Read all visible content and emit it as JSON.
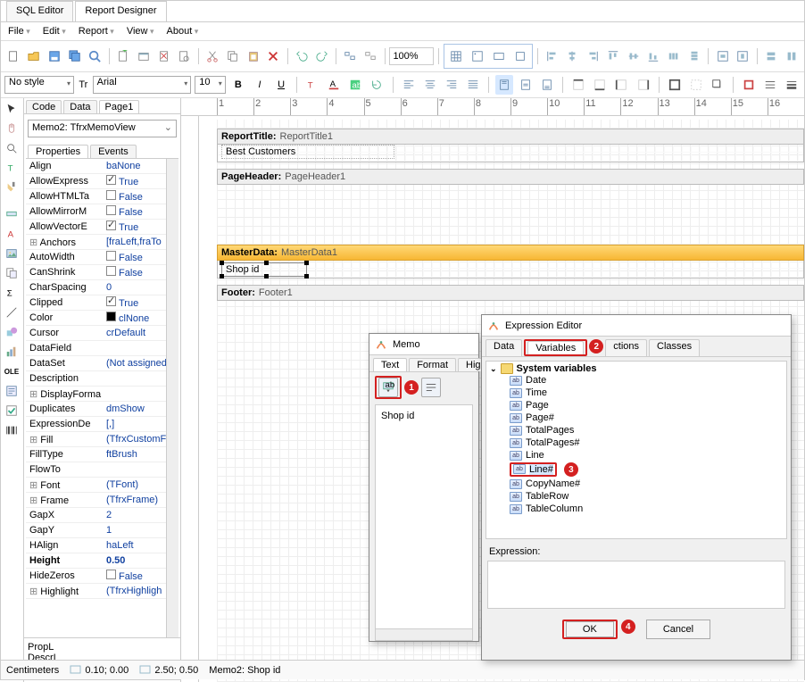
{
  "app_tabs": {
    "sql": "SQL Editor",
    "designer": "Report Designer"
  },
  "menu": {
    "file": "File",
    "edit": "Edit",
    "report": "Report",
    "view": "View",
    "about": "About"
  },
  "toolbar": {
    "zoom": "100%"
  },
  "style": {
    "none": "No style",
    "font": "Arial",
    "size": "10"
  },
  "code_tabs": {
    "code": "Code",
    "data": "Data",
    "page": "Page1"
  },
  "object": "Memo2: TfrxMemoView",
  "pe_tabs": {
    "props": "Properties",
    "events": "Events"
  },
  "props": [
    {
      "k": "Align",
      "v": "baNone"
    },
    {
      "k": "AllowExpress",
      "cb": true,
      "v": "True"
    },
    {
      "k": "AllowHTMLTa",
      "cb": false,
      "v": "False"
    },
    {
      "k": "AllowMirrorM",
      "cb": false,
      "v": "False"
    },
    {
      "k": "AllowVectorE",
      "cb": true,
      "v": "True"
    },
    {
      "k": "Anchors",
      "v": "[fraLeft,fraTo",
      "exp": true
    },
    {
      "k": "AutoWidth",
      "cb": false,
      "v": "False"
    },
    {
      "k": "CanShrink",
      "cb": false,
      "v": "False"
    },
    {
      "k": "CharSpacing",
      "v": "0"
    },
    {
      "k": "Clipped",
      "cb": true,
      "v": "True"
    },
    {
      "k": "Color",
      "sw": true,
      "v": "clNone"
    },
    {
      "k": "Cursor",
      "v": "crDefault"
    },
    {
      "k": "DataField",
      "v": ""
    },
    {
      "k": "DataSet",
      "v": "(Not assigned"
    },
    {
      "k": "Description",
      "v": ""
    },
    {
      "k": "DisplayForma",
      "v": "",
      "exp": true
    },
    {
      "k": "Duplicates",
      "v": "dmShow"
    },
    {
      "k": "ExpressionDe",
      "v": "[,]"
    },
    {
      "k": "Fill",
      "v": "(TfrxCustomF",
      "exp": true
    },
    {
      "k": "FillType",
      "v": "ftBrush"
    },
    {
      "k": "FlowTo",
      "v": ""
    },
    {
      "k": "Font",
      "v": "(TFont)",
      "exp": true
    },
    {
      "k": "Frame",
      "v": "(TfrxFrame)",
      "exp": true
    },
    {
      "k": "GapX",
      "v": "2"
    },
    {
      "k": "GapY",
      "v": "1"
    },
    {
      "k": "HAlign",
      "v": "haLeft"
    },
    {
      "k": "Height",
      "v": "0.50",
      "bold": true
    },
    {
      "k": "HideZeros",
      "cb": false,
      "v": "False"
    },
    {
      "k": "Highlight",
      "v": "(TfrxHighligh",
      "exp": true
    }
  ],
  "bottom": {
    "prop": "PropL",
    "desc": "DescrL"
  },
  "status": {
    "units": "Centimeters",
    "pos1": "0.10; 0.00",
    "pos2": "2.50; 0.50",
    "obj": "Memo2: Shop id"
  },
  "ruler": [
    "1",
    "2",
    "3",
    "4",
    "5",
    "6",
    "7",
    "8",
    "9",
    "10",
    "11",
    "12",
    "13",
    "14",
    "15",
    "16"
  ],
  "bands": {
    "rt": {
      "n": "ReportTitle:",
      "o": "ReportTitle1",
      "text": "Best Customers"
    },
    "ph": {
      "n": "PageHeader:",
      "o": "PageHeader1"
    },
    "md": {
      "n": "MasterData:",
      "o": "MasterData1",
      "text": "Shop id"
    },
    "ft": {
      "n": "Footer:",
      "o": "Footer1"
    }
  },
  "memo_dlg": {
    "title": "Memo",
    "tabs": {
      "text": "Text",
      "format": "Format",
      "hl": "Highli"
    },
    "content": "Shop id"
  },
  "expr_dlg": {
    "title": "Expression Editor",
    "tabs": {
      "data": "Data",
      "vars": "Variables",
      "funcs": "ctions",
      "classes": "Classes"
    },
    "root": "System variables",
    "vars": [
      "Date",
      "Time",
      "Page",
      "Page#",
      "TotalPages",
      "TotalPages#",
      "Line",
      "Line#",
      "CopyName#",
      "TableRow",
      "TableColumn"
    ],
    "expression_label": "Expression:",
    "ok": "OK",
    "cancel": "Cancel"
  },
  "callouts": {
    "1": "1",
    "2": "2",
    "3": "3",
    "4": "4"
  }
}
